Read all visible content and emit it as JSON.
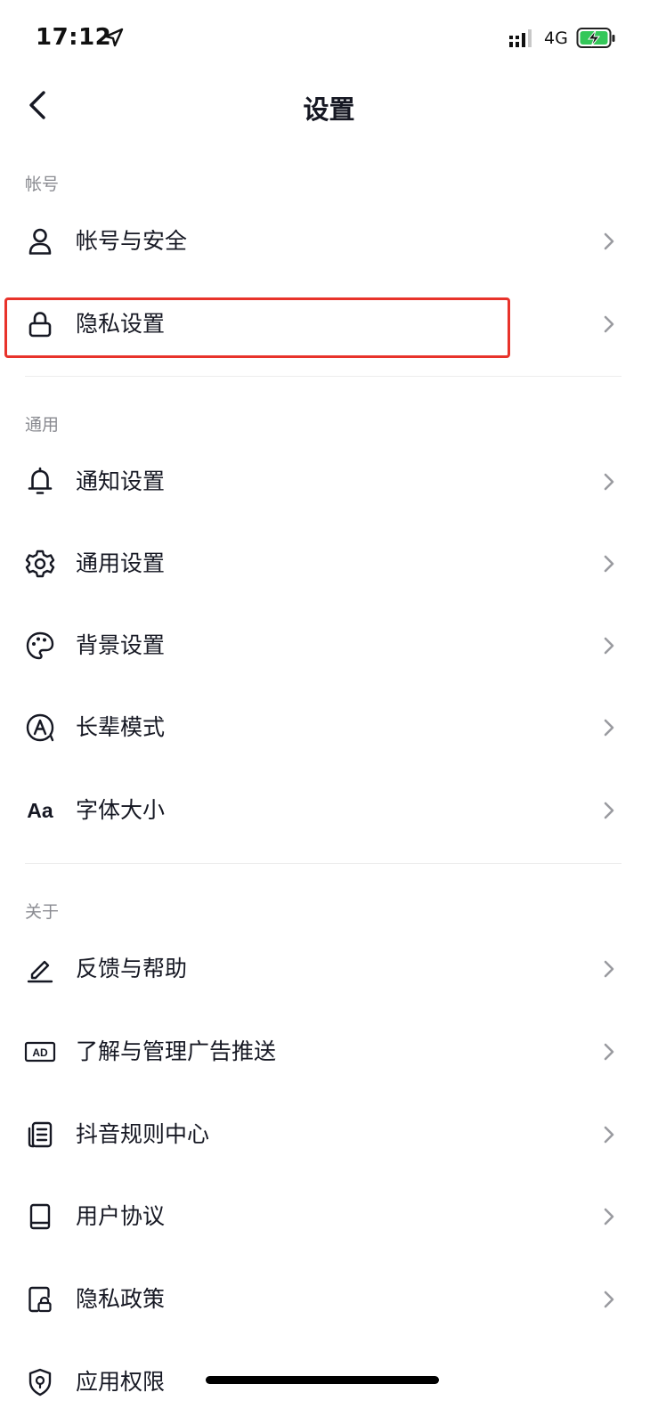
{
  "status_bar": {
    "time": "17:12",
    "network": "4G"
  },
  "nav": {
    "title": "设置"
  },
  "sections": {
    "account": {
      "header": "帐号"
    },
    "general": {
      "header": "通用"
    },
    "about": {
      "header": "关于"
    }
  },
  "items": {
    "account_security": {
      "label": "帐号与安全",
      "icon": "person-icon"
    },
    "privacy_settings": {
      "label": "隐私设置",
      "icon": "lock-icon"
    },
    "notification_settings": {
      "label": "通知设置",
      "icon": "bell-icon"
    },
    "general_settings": {
      "label": "通用设置",
      "icon": "gear-icon"
    },
    "background_settings": {
      "label": "背景设置",
      "icon": "palette-icon"
    },
    "elder_mode": {
      "label": "长辈模式",
      "icon": "elder-mode-icon"
    },
    "font_size": {
      "label": "字体大小",
      "icon_text": "Aa"
    },
    "feedback_help": {
      "label": "反馈与帮助",
      "icon": "pencil-icon"
    },
    "ad_management": {
      "label": "了解与管理广告推送",
      "icon_text": "AD"
    },
    "rules_center": {
      "label": "抖音规则中心",
      "icon": "document-icon"
    },
    "user_agreement": {
      "label": "用户协议",
      "icon": "book-icon"
    },
    "privacy_policy": {
      "label": "隐私政策",
      "icon": "privacy-doc-icon"
    },
    "app_permissions": {
      "label": "应用权限",
      "icon": "shield-location-icon"
    }
  },
  "colors": {
    "highlight": "#e8332b",
    "text_primary": "#161823",
    "text_secondary": "#8a8b91",
    "battery_fill": "#34c759"
  }
}
